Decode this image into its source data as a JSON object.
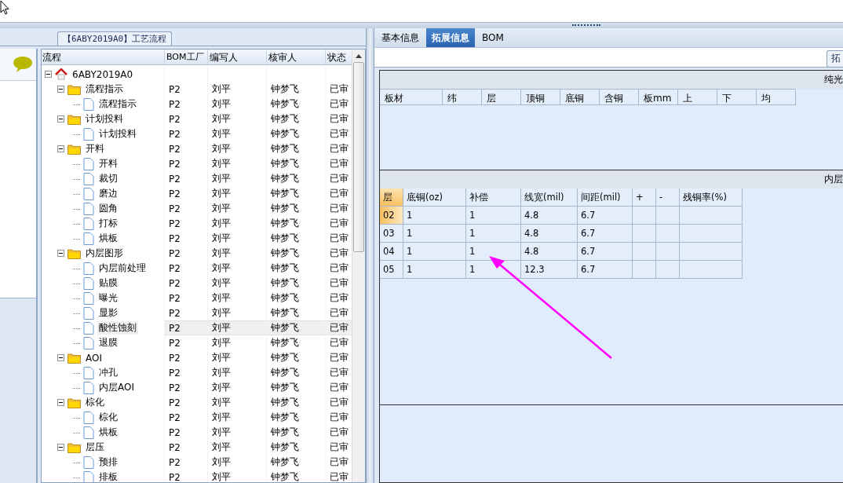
{
  "left_pane": {
    "title": "【6ABY2019A0】工艺流程",
    "tree": {
      "columns": [
        "流程",
        "BOM工厂",
        "编写人",
        "核审人",
        "状态"
      ],
      "rows": [
        {
          "label": "6ABY2019A0",
          "expanded": true,
          "selected": false,
          "children": [
            {
              "label": "流程指示",
              "bom": "P2",
              "author": "刘平",
              "reviewer": "钟梦飞",
              "status": "已审",
              "expanded": true,
              "selected": false,
              "children": [
                {
                  "label": "流程指示",
                  "bom": "P2",
                  "author": "刘平",
                  "reviewer": "钟梦飞",
                  "status": "已审",
                  "selected": false
                }
              ]
            },
            {
              "label": "计划投料",
              "bom": "P2",
              "author": "刘平",
              "reviewer": "钟梦飞",
              "status": "已审",
              "expanded": true,
              "selected": false,
              "children": [
                {
                  "label": "计划投料",
                  "bom": "P2",
                  "author": "刘平",
                  "reviewer": "钟梦飞",
                  "status": "已审",
                  "selected": false
                }
              ]
            },
            {
              "label": "开料",
              "bom": "P2",
              "author": "刘平",
              "reviewer": "钟梦飞",
              "status": "已审",
              "expanded": true,
              "selected": false,
              "children": [
                {
                  "label": "开料",
                  "bom": "P2",
                  "author": "刘平",
                  "reviewer": "钟梦飞",
                  "status": "已审",
                  "selected": false
                },
                {
                  "label": "裁切",
                  "bom": "P2",
                  "author": "刘平",
                  "reviewer": "钟梦飞",
                  "status": "已审",
                  "selected": false
                },
                {
                  "label": "磨边",
                  "bom": "P2",
                  "author": "刘平",
                  "reviewer": "钟梦飞",
                  "status": "已审",
                  "selected": false
                },
                {
                  "label": "圆角",
                  "bom": "P2",
                  "author": "刘平",
                  "reviewer": "钟梦飞",
                  "status": "已审",
                  "selected": false
                },
                {
                  "label": "打标",
                  "bom": "P2",
                  "author": "刘平",
                  "reviewer": "钟梦飞",
                  "status": "已审",
                  "selected": false
                },
                {
                  "label": "烘板",
                  "bom": "P2",
                  "author": "刘平",
                  "reviewer": "钟梦飞",
                  "status": "已审",
                  "selected": false
                }
              ]
            },
            {
              "label": "内层图形",
              "bom": "P2",
              "author": "刘平",
              "reviewer": "钟梦飞",
              "status": "已审",
              "expanded": true,
              "selected": false,
              "children": [
                {
                  "label": "内层前处理",
                  "bom": "P2",
                  "author": "刘平",
                  "reviewer": "钟梦飞",
                  "status": "已审",
                  "selected": false
                },
                {
                  "label": "贴膜",
                  "bom": "P2",
                  "author": "刘平",
                  "reviewer": "钟梦飞",
                  "status": "已审",
                  "selected": false
                },
                {
                  "label": "曝光",
                  "bom": "P2",
                  "author": "刘平",
                  "reviewer": "钟梦飞",
                  "status": "已审",
                  "selected": false
                },
                {
                  "label": "显影",
                  "bom": "P2",
                  "author": "刘平",
                  "reviewer": "钟梦飞",
                  "status": "已审",
                  "selected": false
                },
                {
                  "label": "酸性蚀刻",
                  "bom": "P2",
                  "author": "刘平",
                  "reviewer": "钟梦飞",
                  "status": "已审",
                  "selected": true
                },
                {
                  "label": "退膜",
                  "bom": "P2",
                  "author": "刘平",
                  "reviewer": "钟梦飞",
                  "status": "已审",
                  "selected": false
                }
              ]
            },
            {
              "label": "AOI",
              "bom": "P2",
              "author": "刘平",
              "reviewer": "钟梦飞",
              "status": "已审",
              "expanded": true,
              "selected": false,
              "children": [
                {
                  "label": "冲孔",
                  "bom": "P2",
                  "author": "刘平",
                  "reviewer": "钟梦飞",
                  "status": "已审",
                  "selected": false
                },
                {
                  "label": "内层AOI",
                  "bom": "P2",
                  "author": "刘平",
                  "reviewer": "钟梦飞",
                  "status": "已审",
                  "selected": false
                }
              ]
            },
            {
              "label": "棕化",
              "bom": "P2",
              "author": "刘平",
              "reviewer": "钟梦飞",
              "status": "已审",
              "expanded": true,
              "selected": false,
              "children": [
                {
                  "label": "棕化",
                  "bom": "P2",
                  "author": "刘平",
                  "reviewer": "钟梦飞",
                  "status": "已审",
                  "selected": false
                },
                {
                  "label": "烘板",
                  "bom": "P2",
                  "author": "刘平",
                  "reviewer": "钟梦飞",
                  "status": "已审",
                  "selected": false
                }
              ]
            },
            {
              "label": "层压",
              "bom": "P2",
              "author": "刘平",
              "reviewer": "钟梦飞",
              "status": "已审",
              "expanded": true,
              "selected": false,
              "children": [
                {
                  "label": "预排",
                  "bom": "P2",
                  "author": "刘平",
                  "reviewer": "钟梦飞",
                  "status": "已审",
                  "selected": false
                },
                {
                  "label": "排板",
                  "bom": "P2",
                  "author": "刘平",
                  "reviewer": "钟梦飞",
                  "status": "已审",
                  "selected": false
                }
              ]
            }
          ]
        }
      ]
    }
  },
  "right_pane": {
    "tabs": [
      {
        "label": "基本信息",
        "selected": false
      },
      {
        "label": "拓展信息",
        "selected": true
      },
      {
        "label": "BOM",
        "selected": false
      }
    ],
    "group_tab": "拓",
    "plate_section": {
      "title": "纯光",
      "columns": [
        "板材",
        "纬",
        "层",
        "顶铜",
        "底铜",
        "含铜",
        "板mm",
        "上",
        "下",
        "均"
      ]
    },
    "layer_section": {
      "title": "内层",
      "columns": [
        "层",
        "底铜(oz)",
        "补偿",
        "线宽(mil)",
        "间距(mil)",
        "+",
        "-",
        "残铜率(%)"
      ],
      "rows": [
        {
          "layer": "02",
          "values": [
            "1",
            "1",
            "4.8",
            "6.7"
          ],
          "selected": true
        },
        {
          "layer": "03",
          "values": [
            "1",
            "1",
            "4.8",
            "6.7"
          ],
          "selected": false
        },
        {
          "layer": "04",
          "values": [
            "1",
            "1",
            "4.8",
            "6.7"
          ],
          "selected": false
        },
        {
          "layer": "05",
          "values": [
            "1",
            "1",
            "12.3",
            "6.7"
          ],
          "selected": false
        }
      ]
    }
  }
}
